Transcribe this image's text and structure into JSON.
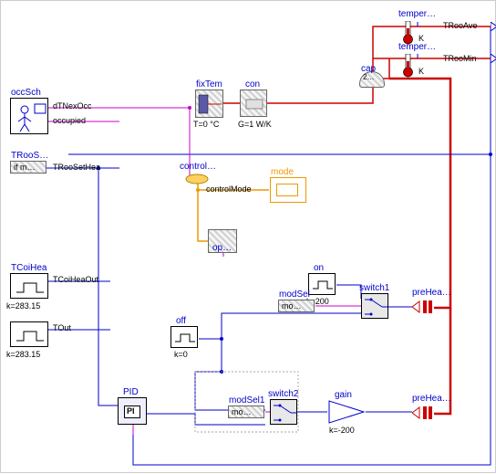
{
  "sensors": {
    "temp1": {
      "title": "temper…",
      "unit": "K",
      "out": "TRooAve"
    },
    "temp2": {
      "title": "temper…",
      "unit": "K",
      "out": "TRooMin"
    }
  },
  "cap": {
    "label": "cap",
    "sub": "2…"
  },
  "fixTem": {
    "label": "fixTem",
    "sub": "T=0 °C"
  },
  "con": {
    "label": "con",
    "sub": "G=1 W/K"
  },
  "occSch": {
    "label": "occSch",
    "out1": "dTNexOcc",
    "out2": "occupied"
  },
  "TRooS": {
    "label": "TRooS…",
    "sub": "if m…",
    "out": "TRooSetHea"
  },
  "controlModeBus": {
    "label": "control…"
  },
  "controlMode": {
    "label": "controlMode"
  },
  "mode": {
    "label": "mode"
  },
  "op": {
    "label": "op…"
  },
  "TCoiHea": {
    "label": "TCoiHea",
    "sub": "k=283.15",
    "out": "TCoiHeaOut"
  },
  "TOut": {
    "out": "TOut",
    "sub": "k=283.15"
  },
  "off": {
    "label": "off",
    "sub": "k=0"
  },
  "on": {
    "label": "on",
    "sub": "k=200"
  },
  "modSel": {
    "label": "modSel",
    "sub": "mo…"
  },
  "modSel1": {
    "label": "modSel1",
    "sub": "mo…"
  },
  "switch1": {
    "label": "switch1"
  },
  "switch2": {
    "label": "switch2"
  },
  "preHea1": {
    "label": "preHea…"
  },
  "preHea2": {
    "label": "preHea…"
  },
  "gain": {
    "label": "gain",
    "sub": "k=-200"
  },
  "PID": {
    "label": "PID",
    "inner": "PI"
  }
}
